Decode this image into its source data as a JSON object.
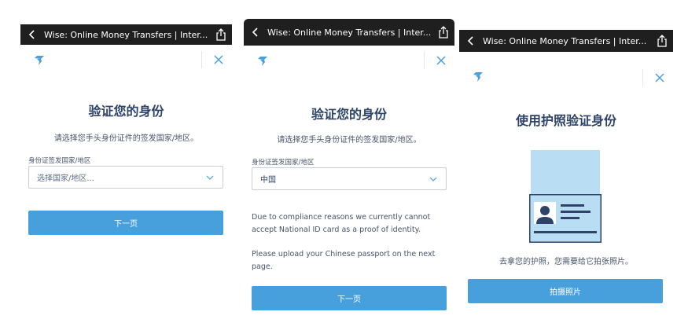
{
  "browser": {
    "page_title": "Wise: Online Money Transfers | Inter..."
  },
  "screen1": {
    "title": "验证您的身份",
    "subtitle": "请选择您手头身份证件的签发国家/地区。",
    "field_label": "身份证签发国家/地区",
    "select_placeholder": "选择国家/地区...",
    "next_button": "下一页"
  },
  "screen2": {
    "title": "验证您的身份",
    "subtitle": "请选择您手头身份证件的签发国家/地区。",
    "field_label": "身份证签发国家/地区",
    "select_value": "中国",
    "notice_1": "Due to compliance reasons we currently cannot accept National ID card as a proof of identity.",
    "notice_2": "Please upload your Chinese passport on the next page.",
    "next_button": "下一页"
  },
  "screen3": {
    "title": "使用护照验证身份",
    "instruction": "去拿您的护照，您需要给它拍张照片。",
    "photo_button": "拍摄照片"
  },
  "icons": {
    "back": "chevron-left-icon",
    "share": "share-icon",
    "logo": "wise-logo-icon",
    "close": "close-icon",
    "dropdown": "chevron-down-icon",
    "passport": "passport-illustration"
  },
  "colors": {
    "accent": "#47a0dc",
    "title_text": "#2e4369",
    "topbar": "#1f1f1f",
    "passport_light": "#b9ddf3",
    "passport_dark": "#2e4369"
  }
}
